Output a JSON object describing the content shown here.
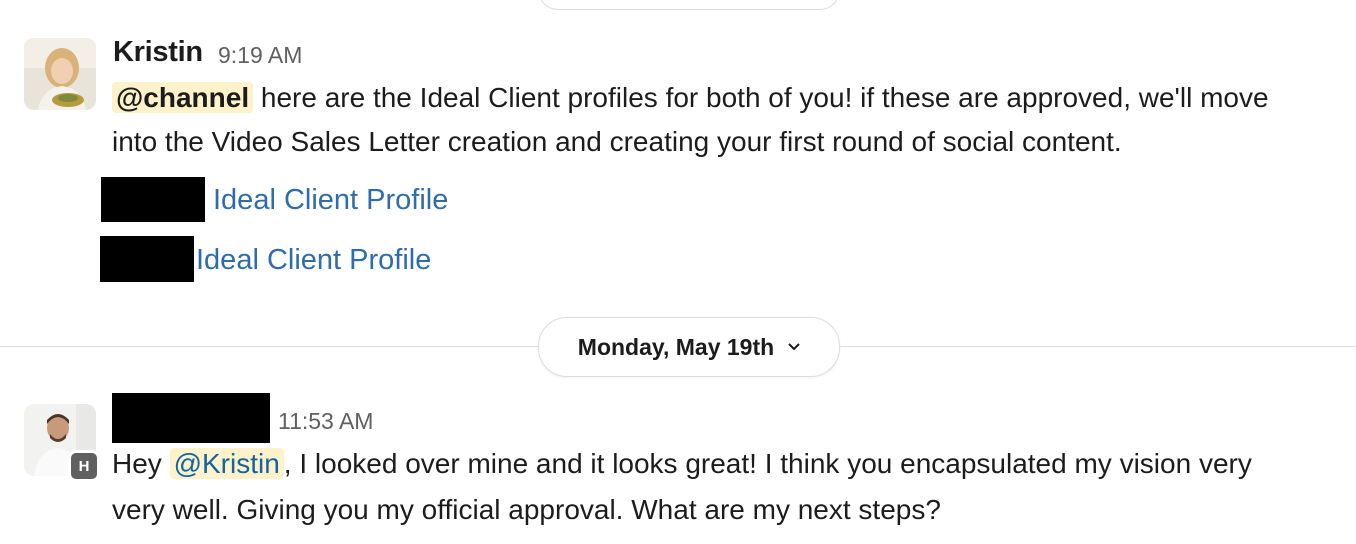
{
  "message1": {
    "sender": "Kristin",
    "time": "9:19 AM",
    "mention": "@channel",
    "line1": " here are the Ideal Client profiles for both of you! if these are approved, we'll move",
    "line2": "into the Video Sales Letter creation and creating your first round of social content.",
    "links": [
      {
        "label": "Ideal Client Profile"
      },
      {
        "label": "Ideal Client Profile"
      }
    ]
  },
  "date_divider": {
    "label": "Monday, May 19th",
    "chevron": "chevron-down-icon"
  },
  "message2": {
    "time": "11:53 AM",
    "badge": "H",
    "prefix": "Hey ",
    "mention": "@Kristin",
    "line1_rest": ", I looked over mine and it looks great! I think you encapsulated my vision very",
    "line2": "very well. Giving you my official approval. What are my next steps?"
  },
  "colors": {
    "link": "#2e6cae",
    "mention_bg": "#fdf2c9",
    "mention_user": "#1264a3",
    "redaction": "#000000"
  }
}
